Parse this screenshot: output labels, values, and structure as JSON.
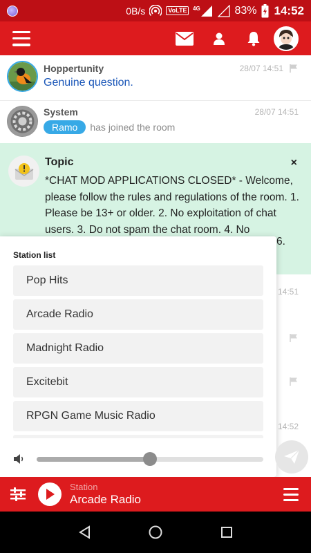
{
  "status_bar": {
    "speed": "0B/s",
    "volte": "VoLTE",
    "network": "4G",
    "battery": "83%",
    "time": "14:52"
  },
  "colors": {
    "brand_red": "#dd1b1e",
    "topic_bg": "#d6f3e3",
    "pill_blue": "#37a9e6"
  },
  "header": {
    "icons": [
      "menu-icon",
      "mail-icon",
      "user-icon",
      "bell-icon",
      "avatar"
    ]
  },
  "messages": [
    {
      "user": "Hoppertunity",
      "time": "28/07 14:51",
      "text": "Genuine question."
    },
    {
      "user": "System",
      "time": "28/07 14:51",
      "pill": "Ramo",
      "text": "has joined the room"
    }
  ],
  "topic": {
    "title": "Topic",
    "close": "×",
    "body": "*CHAT MOD APPLICATIONS CLOSED* - Welcome, please follow the rules and regulations of the room. 1. Please be 13+ or older. 2. No exploitation of chat users. 3. Do not spam the chat room. 4. No",
    "peek_suffix": "6."
  },
  "peek": {
    "time1": "14:51",
    "time2": "14:52"
  },
  "station_panel": {
    "label": "Station list",
    "stations": [
      "Pop Hits",
      "Arcade Radio",
      "Madnight Radio",
      "Excitebit",
      "RPGN Game Music Radio"
    ],
    "volume": 0.5
  },
  "player": {
    "label": "Station",
    "name": "Arcade Radio"
  }
}
